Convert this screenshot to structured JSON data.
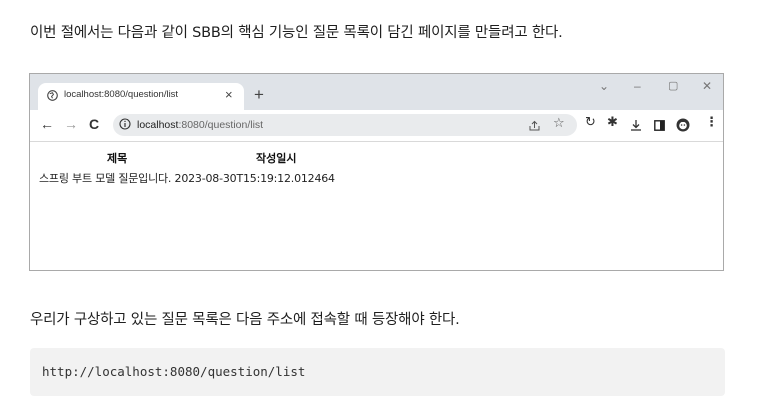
{
  "paragraph1": "이번 절에서는 다음과 같이 SBB의 핵심 기능인 질문 목록이 담긴 페이지를 만들려고 한다.",
  "browser": {
    "tab_title": "localhost:8080/question/list",
    "tab_close": "×",
    "new_tab": "+",
    "window_controls": [
      "⌄",
      "–",
      "▢",
      "✕"
    ],
    "nav": {
      "back": "←",
      "forward": "→",
      "reload": "C"
    },
    "url_host": "localhost",
    "url_path": ":8080/question/list",
    "toolbar_icons": [
      "share-icon",
      "star-icon",
      "refresh-icon",
      "extension-icon",
      "download-icon",
      "sidepanel-icon",
      "profile-icon",
      "menu-icon"
    ],
    "page": {
      "headers": [
        "제목",
        "작성일시"
      ],
      "row": "스프링 부트 모델 질문입니다. 2023-08-30T15:19:12.012464"
    }
  },
  "paragraph2": "우리가 구상하고 있는 질문 목록은 다음 주소에 접속할 때 등장해야 한다.",
  "code": "http://localhost:8080/question/list"
}
